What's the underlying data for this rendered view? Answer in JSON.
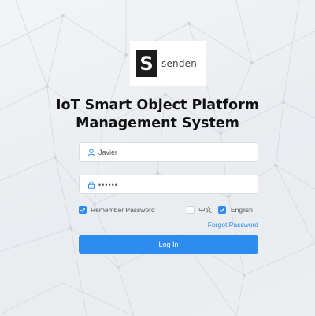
{
  "brand": {
    "logo_letter": "S",
    "logo_text": "senden"
  },
  "title": {
    "line1": "IoT Smart Object Platform",
    "line2": "Management System"
  },
  "form": {
    "username_value": "Javier",
    "password_value": "••••••",
    "remember_password_label": "Remember Password",
    "remember_password_checked": true,
    "language_chinese_label": "中文",
    "language_chinese_checked": false,
    "language_english_label": "English",
    "language_english_checked": true,
    "forgot_password_label": "Forgot Password",
    "login_button_label": "Log In"
  },
  "colors": {
    "accent": "#2d8cf0",
    "background": "#eef0f3",
    "title_text": "#111111"
  },
  "icons": {
    "username_icon": "user-icon",
    "password_icon": "lock-icon",
    "checkbox_checked": "check-icon"
  }
}
